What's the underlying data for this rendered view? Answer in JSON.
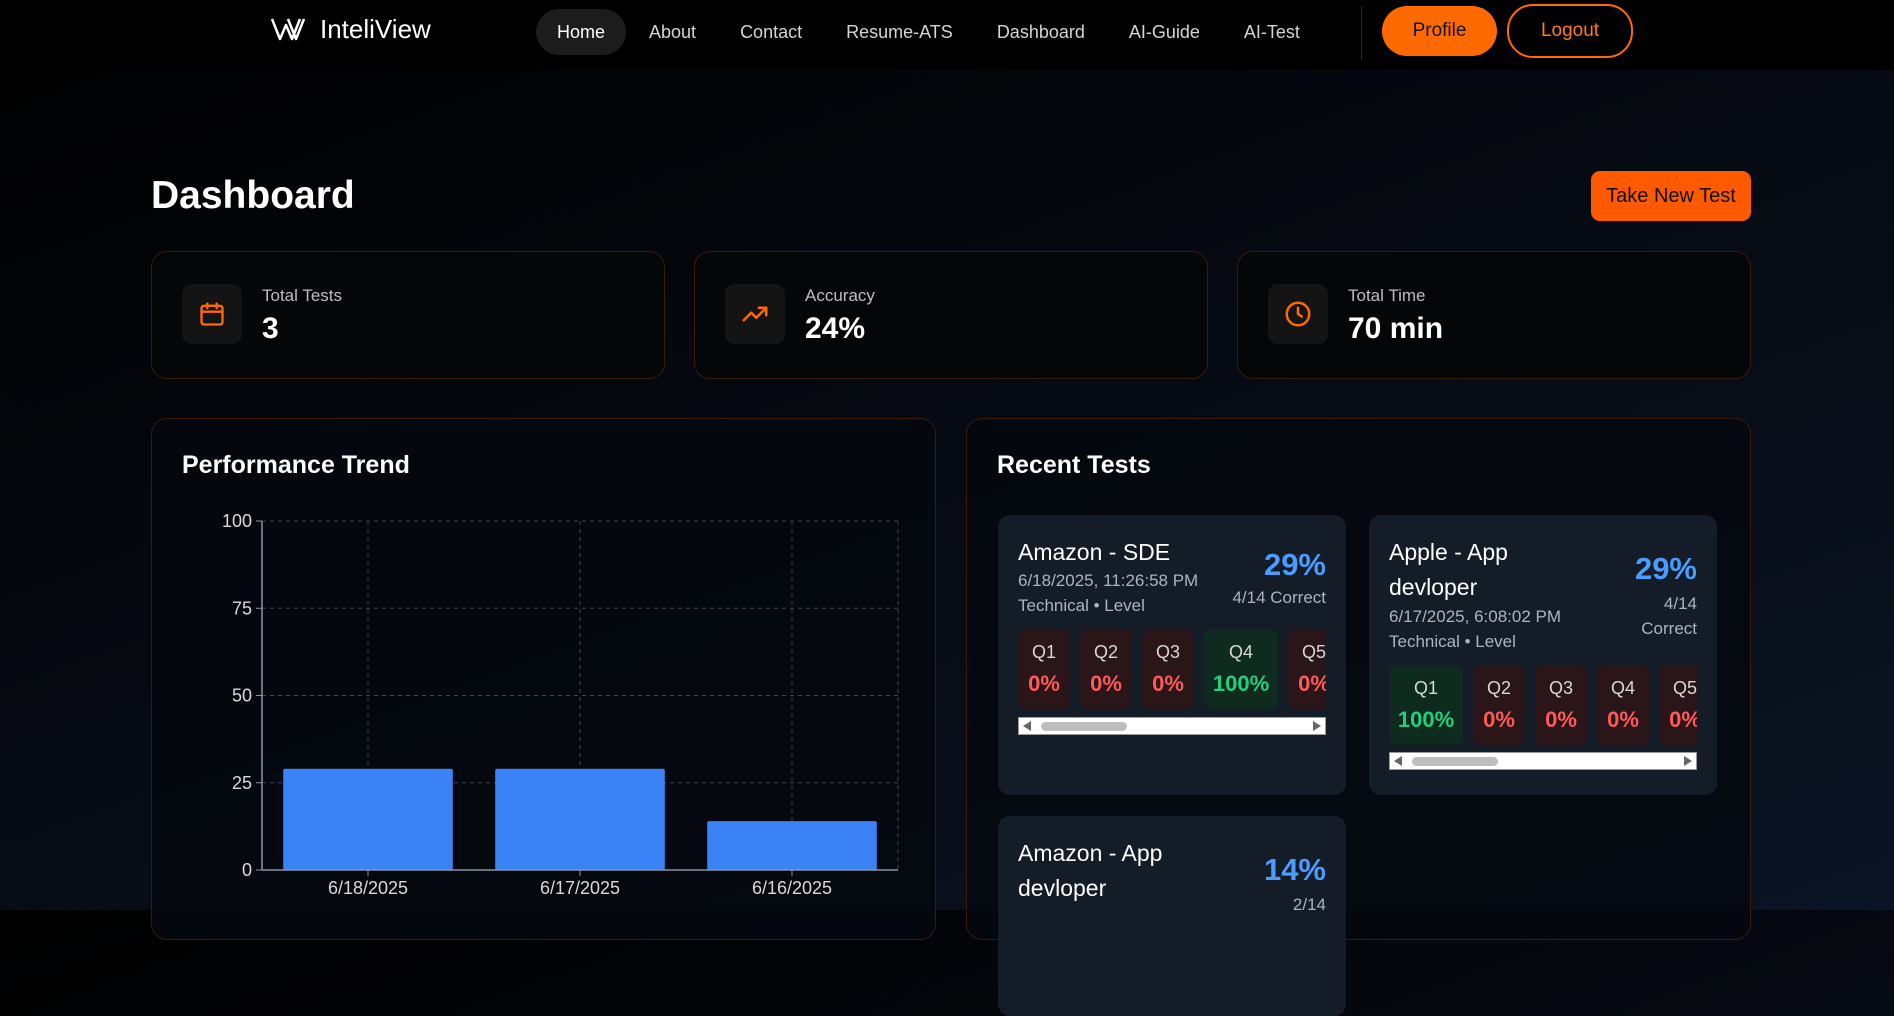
{
  "nav": {
    "logo_text": "InteliView",
    "links": [
      "Home",
      "About",
      "Contact",
      "Resume-ATS",
      "Dashboard",
      "AI-Guide",
      "AI-Test"
    ],
    "active_link": "Home",
    "profile_label": "Profile",
    "logout_label": "Logout"
  },
  "page": {
    "title": "Dashboard",
    "new_test_label": "Take New Test"
  },
  "stats": [
    {
      "label": "Total Tests",
      "value": "3",
      "icon": "calendar-icon"
    },
    {
      "label": "Accuracy",
      "value": "24%",
      "icon": "trending-up-icon"
    },
    {
      "label": "Total Time",
      "value": "70 min",
      "icon": "clock-icon"
    }
  ],
  "colors": {
    "accent": "#ff6a00",
    "bar": "#3b82f6",
    "good": "#22d07a",
    "bad": "#ff5a5a",
    "percent": "#4a9dff"
  },
  "performance": {
    "title": "Performance Trend"
  },
  "chart_data": {
    "type": "bar",
    "categories": [
      "6/18/2025",
      "6/17/2025",
      "6/16/2025"
    ],
    "values": [
      29,
      29,
      14
    ],
    "ylim": [
      0,
      100
    ],
    "yticks": [
      0,
      25,
      50,
      75,
      100
    ],
    "grid": true,
    "xlabel": "",
    "ylabel": ""
  },
  "recent": {
    "title": "Recent Tests",
    "tests": [
      {
        "title": "Amazon - SDE",
        "date": "6/18/2025, 11:26:58 PM",
        "type": "Technical • Level",
        "percent": "29%",
        "correct": "4/14 Correct",
        "questions": [
          {
            "label": "Q1",
            "value": "0%"
          },
          {
            "label": "Q2",
            "value": "0%"
          },
          {
            "label": "Q3",
            "value": "0%"
          },
          {
            "label": "Q4",
            "value": "100%"
          },
          {
            "label": "Q5",
            "value": "0%"
          }
        ]
      },
      {
        "title": "Apple - App devloper",
        "date": "6/17/2025, 6:08:02 PM",
        "type": "Technical • Level",
        "percent": "29%",
        "correct": "4/14 Correct",
        "questions": [
          {
            "label": "Q1",
            "value": "100%"
          },
          {
            "label": "Q2",
            "value": "0%"
          },
          {
            "label": "Q3",
            "value": "0%"
          },
          {
            "label": "Q4",
            "value": "0%"
          },
          {
            "label": "Q5",
            "value": "0%"
          }
        ]
      },
      {
        "title": "Amazon - App devloper",
        "percent": "14%",
        "correct": "2/14"
      }
    ]
  }
}
